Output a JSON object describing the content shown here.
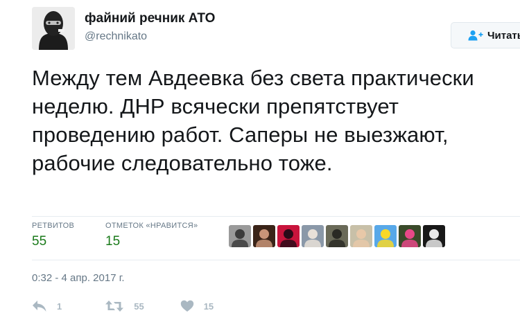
{
  "author": {
    "fullname": "файний речник АТО",
    "handle": "@rechnikato"
  },
  "follow_button": {
    "label": "Читать",
    "icon": "person-plus-icon"
  },
  "tweet": {
    "text": "Между тем Авдеевка без света практически неделю. ДНР всячески препятствует проведению работ. Саперы не выезжают, рабочие следовательно тоже.",
    "timestamp": "0:32 - 4 апр. 2017 г."
  },
  "stats": {
    "retweets_label": "РЕТВИТОВ",
    "retweets_value": "55",
    "likes_label": "ОТМЕТОК «НРАВИТСЯ»",
    "likes_value": "15",
    "liker_avatars": [
      {
        "bg": "#9a9a9a",
        "fg": "#3c3c3c"
      },
      {
        "bg": "#3a2418",
        "fg": "#c89478"
      },
      {
        "bg": "#c8143c",
        "fg": "#2a0a18"
      },
      {
        "bg": "#8a98a8",
        "fg": "#e8e0d8"
      },
      {
        "bg": "#6a6a58",
        "fg": "#2a2a24"
      },
      {
        "bg": "#c8c0a8",
        "fg": "#e8c8a8"
      },
      {
        "bg": "#58a8e8",
        "fg": "#f8d828"
      },
      {
        "bg": "#3a4a2a",
        "fg": "#e84888"
      },
      {
        "bg": "#181818",
        "fg": "#e8e8e8"
      }
    ]
  },
  "actions": {
    "reply_count": "1",
    "retweet_count": "55",
    "like_count": "15"
  },
  "colors": {
    "text": "#14171a",
    "muted": "#657786",
    "stat_value": "#1a7a1a",
    "action_icon": "#aab8c2",
    "follow_icon": "#1da1f2"
  }
}
